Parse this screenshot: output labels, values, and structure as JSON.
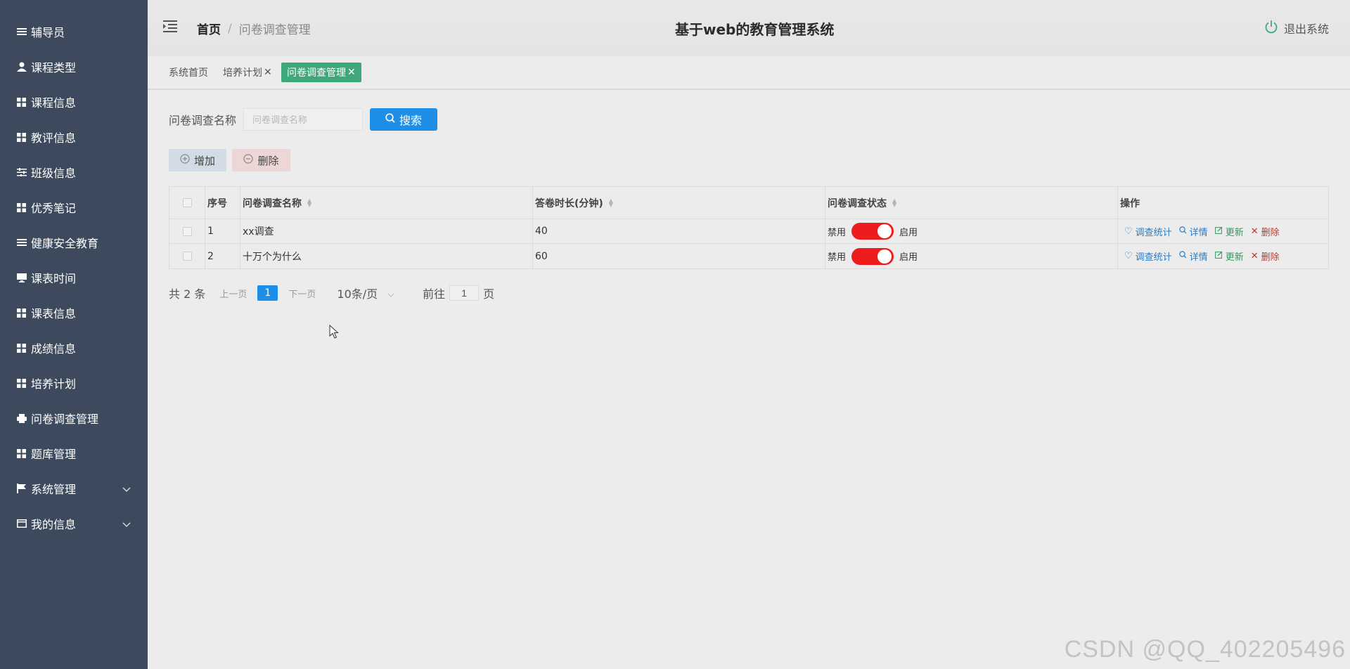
{
  "sidebar": {
    "items": [
      {
        "label": "辅导员",
        "icon": "list-icon"
      },
      {
        "label": "课程类型",
        "icon": "user-icon"
      },
      {
        "label": "课程信息",
        "icon": "grid-icon"
      },
      {
        "label": "教评信息",
        "icon": "grid-icon"
      },
      {
        "label": "班级信息",
        "icon": "sliders-icon"
      },
      {
        "label": "优秀笔记",
        "icon": "grid-icon"
      },
      {
        "label": "健康安全教育",
        "icon": "list-icon"
      },
      {
        "label": "课表时间",
        "icon": "monitor-icon"
      },
      {
        "label": "课表信息",
        "icon": "grid-icon"
      },
      {
        "label": "成绩信息",
        "icon": "grid-icon"
      },
      {
        "label": "培养计划",
        "icon": "grid-icon"
      },
      {
        "label": "问卷调查管理",
        "icon": "print-icon"
      },
      {
        "label": "题库管理",
        "icon": "grid-icon"
      },
      {
        "label": "系统管理",
        "icon": "flag-icon"
      },
      {
        "label": "我的信息",
        "icon": "card-icon"
      }
    ]
  },
  "header": {
    "breadcrumb_home": "首页",
    "breadcrumb_sep": "/",
    "breadcrumb_current": "问卷调查管理",
    "title": "基于web的教育管理系统",
    "logout_label": "退出系统"
  },
  "tags": [
    {
      "label": "系统首页",
      "closable": false,
      "active": false
    },
    {
      "label": "培养计划",
      "closable": true,
      "active": false
    },
    {
      "label": "问卷调查管理",
      "closable": true,
      "active": true
    }
  ],
  "search": {
    "label": "问卷调查名称",
    "placeholder": "问卷调查名称",
    "button_label": "搜索"
  },
  "actions": {
    "add_label": "增加",
    "delete_label": "删除"
  },
  "table": {
    "headers": [
      "序号",
      "问卷调查名称",
      "答卷时长(分钟)",
      "问卷调查状态",
      "操作"
    ],
    "rows": [
      {
        "index": "1",
        "name": "xx调查",
        "duration": "40",
        "status_off": "禁用",
        "status_on": "启用"
      },
      {
        "index": "2",
        "name": "十万个为什么",
        "duration": "60",
        "status_off": "禁用",
        "status_on": "启用"
      }
    ],
    "op_labels": {
      "stat": "调查统计",
      "detail": "详情",
      "update": "更新",
      "remove": "删除"
    }
  },
  "pagination": {
    "total": "共 2 条",
    "prev": "上一页",
    "current": "1",
    "next": "下一页",
    "page_size": "10条/页",
    "goto_prefix": "前往",
    "goto_value": "1",
    "goto_suffix": "页"
  },
  "colors": {
    "sidebar_bg": "#3d4a5d",
    "primary": "#1e8ee6",
    "active_tag": "#3fa87a",
    "switch_on": "#ee1d1d"
  },
  "watermark": "CSDN @QQ_402205496"
}
